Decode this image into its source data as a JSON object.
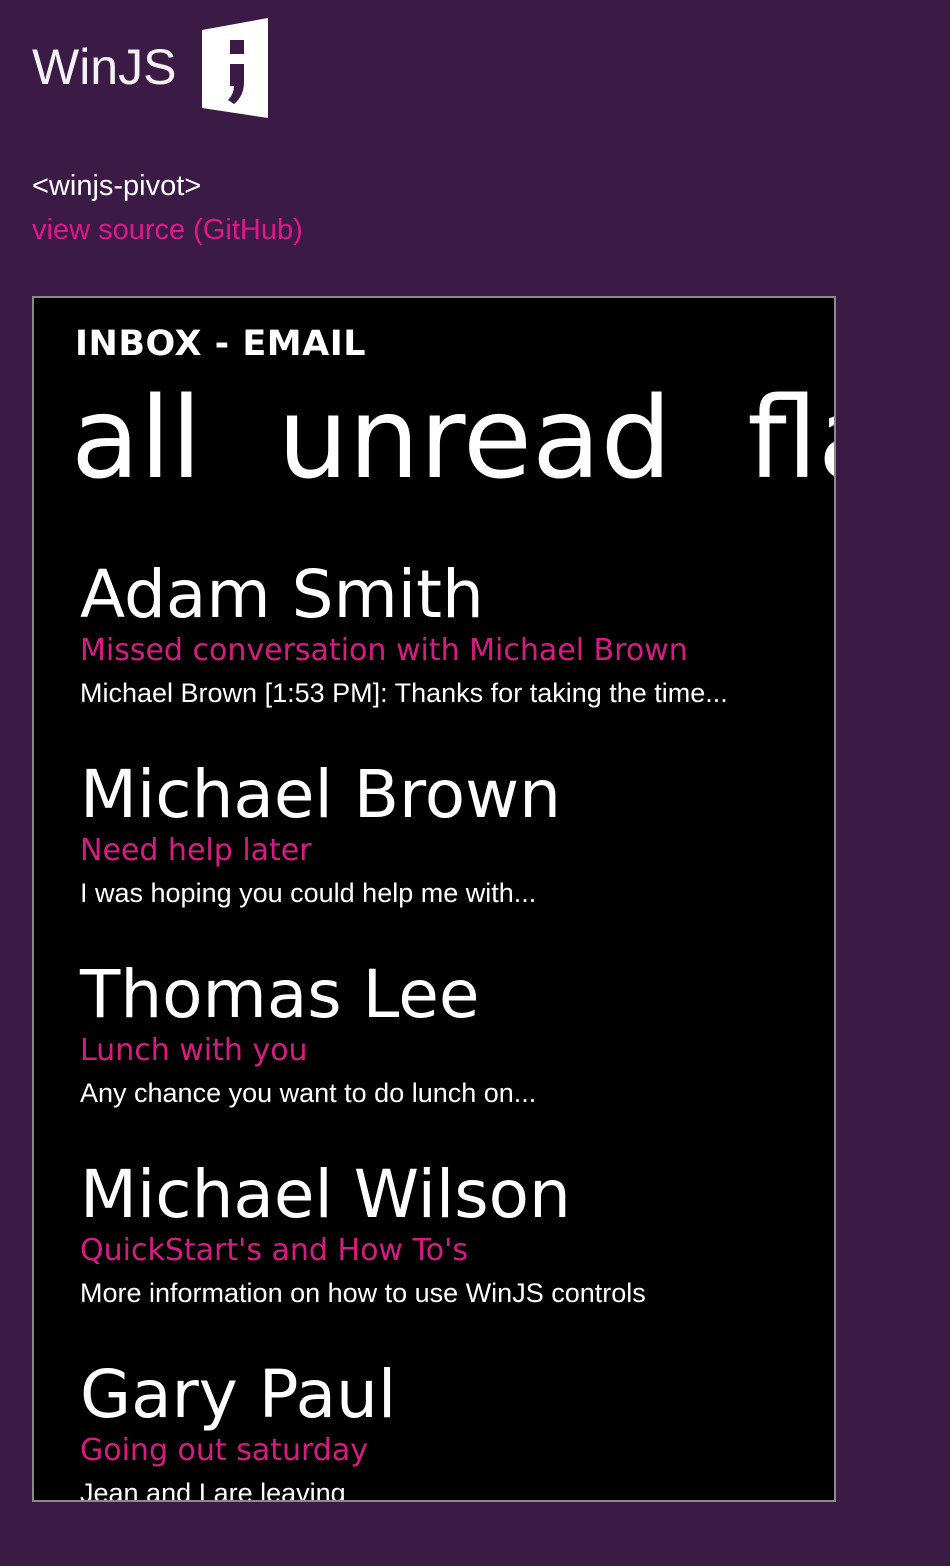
{
  "logo": {
    "text": "WinJS"
  },
  "tag_name": "<winjs-pivot>",
  "source_link": "view source (GitHub)",
  "pivot": {
    "title": "INBOX - EMAIL",
    "headers": [
      "all",
      "unread",
      "flagged"
    ],
    "selected_index": 0,
    "items": [
      {
        "name": "Adam Smith",
        "subject": "Missed conversation with Michael Brown",
        "preview": "Michael Brown [1:53 PM]: Thanks for taking the time..."
      },
      {
        "name": "Michael Brown",
        "subject": "Need help later",
        "preview": "I was hoping you could help me with..."
      },
      {
        "name": "Thomas Lee",
        "subject": "Lunch with you",
        "preview": "Any chance you want to do lunch on..."
      },
      {
        "name": "Michael Wilson",
        "subject": "QuickStart's and How To's",
        "preview": "More information on how to use WinJS controls"
      },
      {
        "name": "Gary Paul",
        "subject": "Going out saturday",
        "preview": "Jean and I are leaving"
      }
    ]
  },
  "colors": {
    "page_background": "#3c1a46",
    "accent": "#d81b83",
    "link": "#e0178a",
    "pivot_background": "#000000"
  }
}
